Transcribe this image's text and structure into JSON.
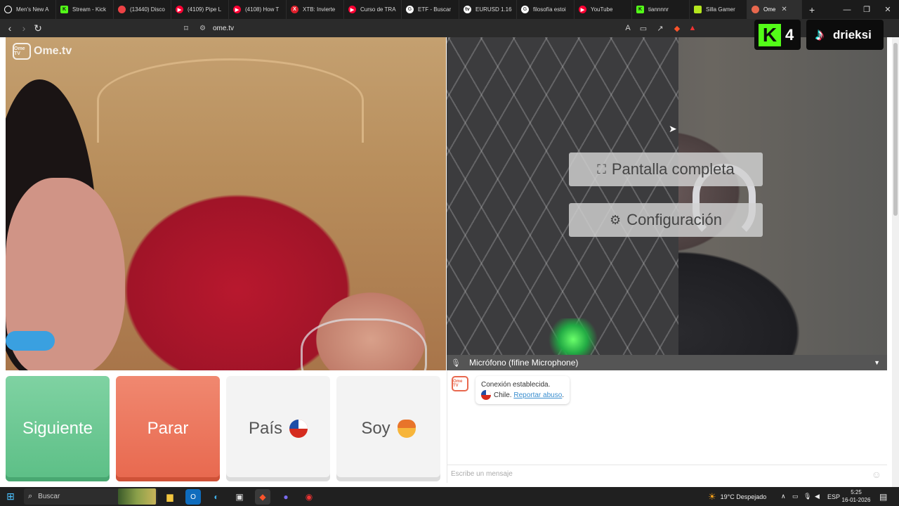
{
  "browser": {
    "tabs": [
      {
        "label": "Men's New A",
        "icon": "github-icon",
        "icon_color": "#ffffff"
      },
      {
        "label": "Stream - Kick",
        "icon": "kick-icon",
        "icon_color": "#53fc18"
      },
      {
        "label": "(13440) Disco",
        "icon": "discord-icon",
        "icon_color": "#ed4245"
      },
      {
        "label": "(4109) Pipe L",
        "icon": "youtube-icon",
        "icon_color": "#ff0033"
      },
      {
        "label": "(4108) How T",
        "icon": "youtube-icon",
        "icon_color": "#ff0033"
      },
      {
        "label": "XTB: Invierte",
        "icon": "xtb-icon",
        "icon_color": "#e0202c"
      },
      {
        "label": "Curso de TRA",
        "icon": "youtube-icon",
        "icon_color": "#ff0033"
      },
      {
        "label": "ETF - Buscar",
        "icon": "google-icon",
        "icon_color": "#ffffff"
      },
      {
        "label": "EURUSD 1.16",
        "icon": "tradingview-icon",
        "icon_color": "#ffffff"
      },
      {
        "label": "filosofía estoi",
        "icon": "google-icon",
        "icon_color": "#ffffff"
      },
      {
        "label": "YouTube",
        "icon": "youtube-icon",
        "icon_color": "#ff0033"
      },
      {
        "label": "tiannnnr",
        "icon": "kick-icon",
        "icon_color": "#53fc18"
      },
      {
        "label": "Silla Gamer",
        "icon": "shop-icon",
        "icon_color": "#b4e61e"
      },
      {
        "label": "Ome",
        "icon": "ometv-icon",
        "icon_color": "#e8684e",
        "active": true
      }
    ],
    "url": "ome.tv"
  },
  "ometv": {
    "logo_text": "Ome.tv",
    "logo_badge": "Ome TV",
    "overlay": {
      "fullscreen_label": "Pantalla completa",
      "settings_label": "Configuración"
    },
    "mic_label": "Micrófono (fifine Microphone)",
    "buttons": {
      "next": "Siguiente",
      "stop": "Parar",
      "country": "País",
      "gender": "Soy"
    },
    "chat": {
      "line1": "Conexión establecida.",
      "country": "Chile.",
      "report_link": "Reportar abuso",
      "link_suffix": ".",
      "placeholder": "Escribe un mensaje"
    }
  },
  "stream_overlay": {
    "kick_count": "4",
    "tiktok_handle": "drieksi"
  },
  "taskbar": {
    "search_label": "Buscar",
    "weather": "19°C  Despejado",
    "language": "ESP",
    "time": "5:25",
    "date": "16-01-2026"
  },
  "colors": {
    "next_green": "#5cbf86",
    "stop_red": "#e8684e",
    "link_blue": "#3a8ecf"
  }
}
